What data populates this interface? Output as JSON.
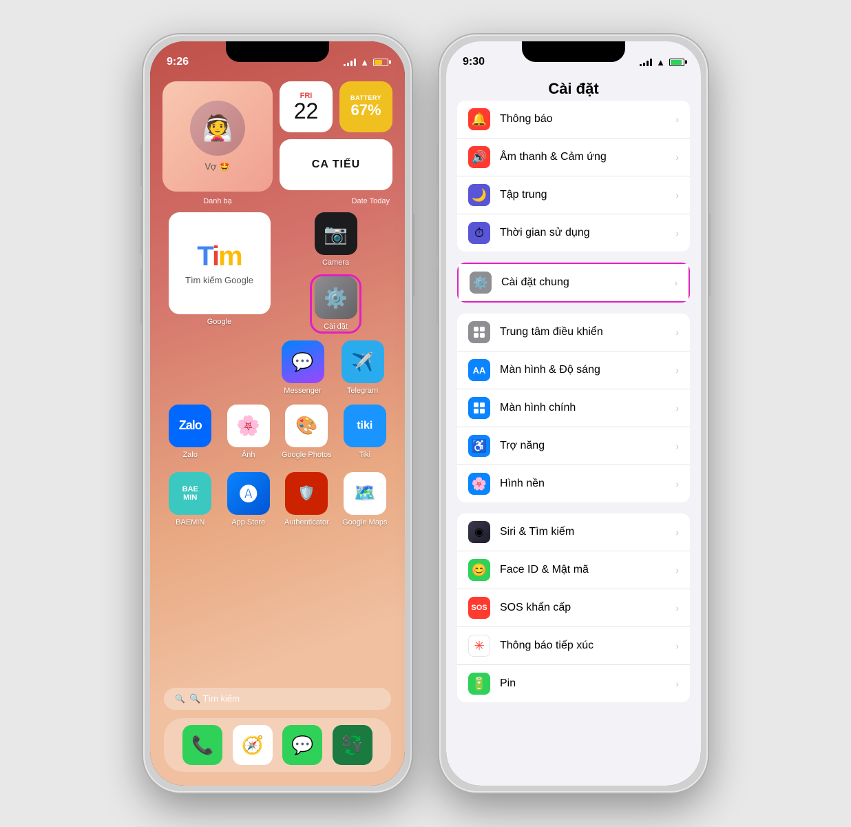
{
  "phone1": {
    "statusBar": {
      "time": "9:26",
      "battery": "67%"
    },
    "widgets": {
      "contact": {
        "name": "Vợ 🤩",
        "label": "Danh bạ"
      },
      "date": {
        "dayName": "FRI",
        "dayNum": "22",
        "label": "Date Today"
      },
      "battery": {
        "label": "BATTERY",
        "percentage": "67%"
      },
      "catieu": {
        "text": "CA TIẾU"
      }
    },
    "apps": {
      "row1": [
        {
          "id": "google",
          "name": "Google",
          "type": "widget"
        },
        {
          "id": "camera",
          "name": "Camera",
          "bg": "#1c1c1e"
        },
        {
          "id": "settings",
          "name": "Cài đặt",
          "bg": "#636366",
          "highlight": true
        }
      ],
      "row2": [
        {
          "id": "zalo",
          "name": "Zalo",
          "bg": "#0068ff"
        },
        {
          "id": "photos_apple",
          "name": "Ảnh",
          "bg": "#fff"
        },
        {
          "id": "google_photos",
          "name": "Google Photos",
          "bg": "#fff"
        },
        {
          "id": "tiki",
          "name": "Tiki",
          "bg": "#1a94ff"
        }
      ],
      "row3": [
        {
          "id": "baemin",
          "name": "BAEMIN",
          "bg": "#3bc8c0"
        },
        {
          "id": "appstore",
          "name": "App Store",
          "bg": "#0a84ff"
        },
        {
          "id": "authenticator",
          "name": "Authenticator",
          "bg": "#cc2200"
        },
        {
          "id": "maps",
          "name": "Google Maps",
          "bg": "#fff"
        }
      ],
      "messenger": {
        "name": "Messenger",
        "bg": "#0084ff"
      },
      "telegram": {
        "name": "Telegram",
        "bg": "#2aabee"
      }
    },
    "searchBar": {
      "placeholder": "🔍 Tìm kiếm"
    },
    "dock": [
      {
        "id": "phone",
        "bg": "#30d158"
      },
      {
        "id": "safari",
        "bg": "#fff"
      },
      {
        "id": "messages",
        "bg": "#30d158"
      },
      {
        "id": "sideline",
        "bg": "#1a7a40"
      }
    ]
  },
  "phone2": {
    "statusBar": {
      "time": "9:30"
    },
    "title": "Cài đặt",
    "settingsItems": [
      {
        "id": "notifications",
        "label": "Thông báo",
        "iconBg": "#ff3b30",
        "iconColor": "#fff",
        "icon": "🔔"
      },
      {
        "id": "sound",
        "label": "Âm thanh & Cảm ứng",
        "iconBg": "#ff3b30",
        "iconColor": "#fff",
        "icon": "🔊"
      },
      {
        "id": "focus",
        "label": "Tập trung",
        "iconBg": "#5856d6",
        "iconColor": "#fff",
        "icon": "🌙"
      },
      {
        "id": "screentime",
        "label": "Thời gian sử dụng",
        "iconBg": "#5856d6",
        "iconColor": "#fff",
        "icon": "⏱"
      },
      {
        "id": "general",
        "label": "Cài đặt chung",
        "iconBg": "#8e8e93",
        "iconColor": "#fff",
        "icon": "⚙️",
        "highlighted": true
      },
      {
        "id": "controlcenter",
        "label": "Trung tâm điều khiển",
        "iconBg": "#8e8e93",
        "iconColor": "#fff",
        "icon": "⊞"
      },
      {
        "id": "display",
        "label": "Màn hình & Độ sáng",
        "iconBg": "#0a84ff",
        "iconColor": "#fff",
        "icon": "AA"
      },
      {
        "id": "homescreen",
        "label": "Màn hình chính",
        "iconBg": "#0a84ff",
        "iconColor": "#fff",
        "icon": "⊞"
      },
      {
        "id": "accessibility",
        "label": "Trợ năng",
        "iconBg": "#0a84ff",
        "iconColor": "#fff",
        "icon": "♿"
      },
      {
        "id": "wallpaper",
        "label": "Hình nền",
        "iconBg": "#0a84ff",
        "iconColor": "#fff",
        "icon": "🌸"
      },
      {
        "id": "siri",
        "label": "Siri & Tìm kiếm",
        "iconBg": "#000",
        "iconColor": "#fff",
        "icon": "◉"
      },
      {
        "id": "faceid",
        "label": "Face ID & Mật mã",
        "iconBg": "#30d158",
        "iconColor": "#fff",
        "icon": "😊"
      },
      {
        "id": "sos",
        "label": "SOS khẩn cấp",
        "iconBg": "#ff3b30",
        "iconColor": "#fff",
        "icon": "SOS"
      },
      {
        "id": "exposure",
        "label": "Thông báo tiếp xúc",
        "iconBg": "#fff",
        "iconColor": "#ff3b30",
        "icon": "✳"
      },
      {
        "id": "battery",
        "label": "Pin",
        "iconBg": "#30d158",
        "iconColor": "#fff",
        "icon": "🔋"
      }
    ]
  }
}
